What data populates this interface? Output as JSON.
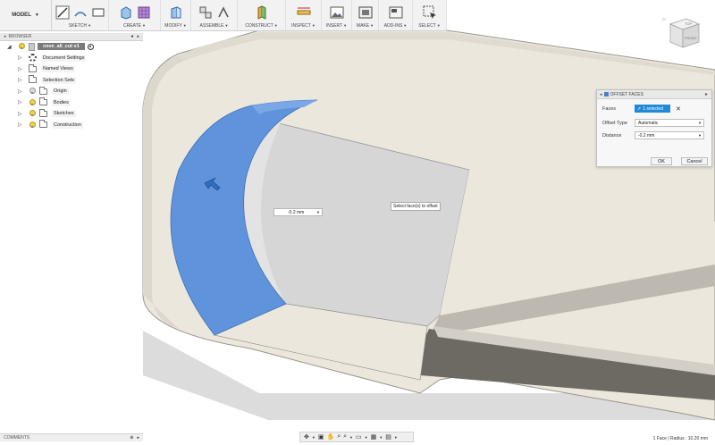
{
  "toolbar": {
    "workspace": "MODEL",
    "groups": [
      {
        "label": "SKETCH"
      },
      {
        "label": "CREATE"
      },
      {
        "label": "MODIFY"
      },
      {
        "label": "ASSEMBLE"
      },
      {
        "label": "CONSTRUCT"
      },
      {
        "label": "INSPECT"
      },
      {
        "label": "INSERT"
      },
      {
        "label": "MAKE"
      },
      {
        "label": "ADD-INS"
      },
      {
        "label": "SELECT"
      }
    ]
  },
  "browser": {
    "title": "BROWSER",
    "document": "cove_all_cut v1",
    "items": [
      {
        "label": "Document Settings"
      },
      {
        "label": "Named Views"
      },
      {
        "label": "Selection Sets"
      },
      {
        "label": "Origin"
      },
      {
        "label": "Bodies"
      },
      {
        "label": "Sketches"
      },
      {
        "label": "Construction"
      }
    ]
  },
  "dialog": {
    "title": "OFFSET FACES",
    "faces_label": "Faces",
    "faces_value": "1 selected",
    "offset_type_label": "Offset Type",
    "offset_type_value": "Automatic",
    "distance_label": "Distance",
    "distance_value": "-0.2 mm",
    "ok_label": "OK",
    "cancel_label": "Cancel"
  },
  "canvas": {
    "distance_input": "-0.2 mm",
    "tooltip": "Select face(s) to offset"
  },
  "viewcube": {
    "top": "TOP",
    "front": "FRONT"
  },
  "comments": {
    "title": "COMMENTS"
  },
  "status": {
    "text": "1 Face | Radius : 10.20 mm"
  },
  "colors": {
    "selected_face": "#5f94dc",
    "body": "#ece7dd",
    "accent": "#1f8ad8"
  }
}
